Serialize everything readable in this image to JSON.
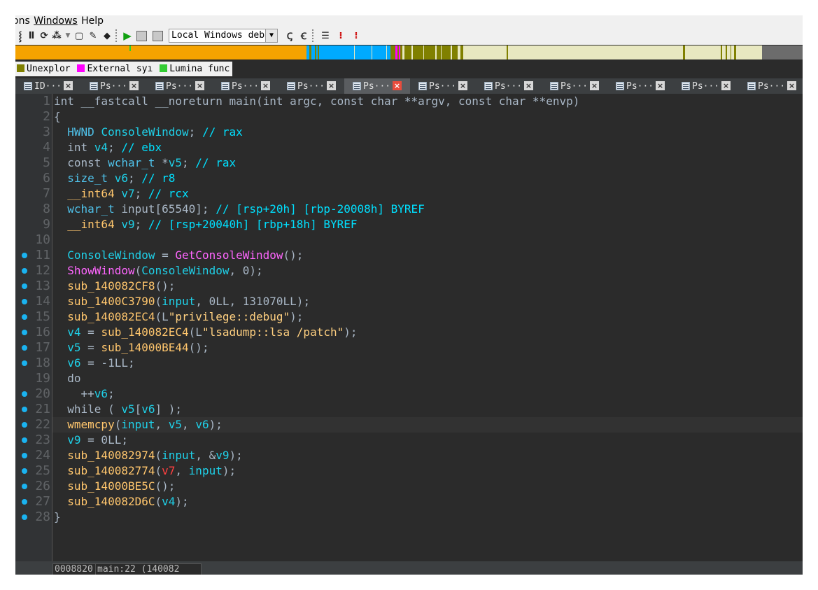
{
  "menubar": {
    "items": [
      "ons",
      "Windows",
      "Help"
    ]
  },
  "toolbar": {
    "debugger_select": "Local Windows deb",
    "icons": [
      "view-icon",
      "trace-icon",
      "loop-icon",
      "struct-icon",
      "dropdown-icon",
      "frame-icon",
      "edit-icon",
      "diamond-icon",
      "play-icon",
      "pause-icon",
      "stop-icon",
      "attach-icon",
      "detach-icon",
      "step-into-icon",
      "step-over-icon",
      "step-out-icon"
    ]
  },
  "legend": {
    "items": [
      {
        "label": "Unexplor",
        "color": "#808000"
      },
      {
        "label": "External syı",
        "color": "#ff00ff"
      },
      {
        "label": "Lumina func",
        "color": "#33cc33"
      }
    ]
  },
  "tabs": [
    {
      "label": "ID···",
      "active": false
    },
    {
      "label": "Ps···",
      "active": false
    },
    {
      "label": "Ps···",
      "active": false
    },
    {
      "label": "Ps···",
      "active": false
    },
    {
      "label": "Ps···",
      "active": false
    },
    {
      "label": "Ps···",
      "active": true
    },
    {
      "label": "Ps···",
      "active": false
    },
    {
      "label": "Ps···",
      "active": false
    },
    {
      "label": "Ps···",
      "active": false
    },
    {
      "label": "Ps···",
      "active": false
    },
    {
      "label": "Ps···",
      "active": false
    },
    {
      "label": "Ps···",
      "active": false
    }
  ],
  "colors": {
    "default": "#a9b7c6",
    "keyword": "#a9b7c6",
    "type": "#4fc1e9",
    "comment": "#00e0ff",
    "local": "#1fd0e8",
    "func": "#ffc66d",
    "import": "#ff66ff",
    "string": "#ffd080",
    "number": "#a9b7c6",
    "unk": "#ff4040",
    "breakpoint": "#1ab3f0"
  },
  "code": {
    "current_line": 22,
    "lines": [
      {
        "n": 1,
        "bp": false,
        "t": [
          [
            "default",
            "int __fastcall __noreturn main(int argc, const char **argv, const char **envp)"
          ]
        ]
      },
      {
        "n": 2,
        "bp": false,
        "t": [
          [
            "default",
            "{"
          ]
        ]
      },
      {
        "n": 3,
        "bp": false,
        "t": [
          [
            "default",
            "  "
          ],
          [
            "type",
            "HWND"
          ],
          [
            "default",
            " "
          ],
          [
            "local",
            "ConsoleWindow"
          ],
          [
            "default",
            "; "
          ],
          [
            "comment",
            "// rax"
          ]
        ]
      },
      {
        "n": 4,
        "bp": false,
        "t": [
          [
            "default",
            "  int "
          ],
          [
            "local",
            "v4"
          ],
          [
            "default",
            "; "
          ],
          [
            "comment",
            "// ebx"
          ]
        ]
      },
      {
        "n": 5,
        "bp": false,
        "t": [
          [
            "default",
            "  const "
          ],
          [
            "type",
            "wchar_t"
          ],
          [
            "default",
            " *"
          ],
          [
            "local",
            "v5"
          ],
          [
            "default",
            "; "
          ],
          [
            "comment",
            "// rax"
          ]
        ]
      },
      {
        "n": 6,
        "bp": false,
        "t": [
          [
            "default",
            "  "
          ],
          [
            "type",
            "size_t"
          ],
          [
            "default",
            " "
          ],
          [
            "local",
            "v6"
          ],
          [
            "default",
            "; "
          ],
          [
            "comment",
            "// r8"
          ]
        ]
      },
      {
        "n": 7,
        "bp": false,
        "t": [
          [
            "default",
            "  "
          ],
          [
            "func",
            "__int64"
          ],
          [
            "default",
            " "
          ],
          [
            "local",
            "v7"
          ],
          [
            "default",
            "; "
          ],
          [
            "comment",
            "// rcx"
          ]
        ]
      },
      {
        "n": 8,
        "bp": false,
        "t": [
          [
            "default",
            "  "
          ],
          [
            "type",
            "wchar_t"
          ],
          [
            "default",
            " input[65540]; "
          ],
          [
            "comment",
            "// [rsp+20h] [rbp-20008h] BYREF"
          ]
        ]
      },
      {
        "n": 9,
        "bp": false,
        "t": [
          [
            "default",
            "  "
          ],
          [
            "func",
            "__int64"
          ],
          [
            "default",
            " "
          ],
          [
            "local",
            "v9"
          ],
          [
            "default",
            "; "
          ],
          [
            "comment",
            "// [rsp+20040h] [rbp+18h] BYREF"
          ]
        ]
      },
      {
        "n": 10,
        "bp": false,
        "t": [
          [
            "default",
            ""
          ]
        ]
      },
      {
        "n": 11,
        "bp": true,
        "t": [
          [
            "default",
            "  "
          ],
          [
            "local",
            "ConsoleWindow"
          ],
          [
            "default",
            " = "
          ],
          [
            "import",
            "GetConsoleWindow"
          ],
          [
            "default",
            "();"
          ]
        ]
      },
      {
        "n": 12,
        "bp": true,
        "t": [
          [
            "default",
            "  "
          ],
          [
            "import",
            "ShowWindow"
          ],
          [
            "default",
            "("
          ],
          [
            "local",
            "ConsoleWindow"
          ],
          [
            "default",
            ", 0);"
          ]
        ]
      },
      {
        "n": 13,
        "bp": true,
        "t": [
          [
            "default",
            "  "
          ],
          [
            "func",
            "sub_140082CF8"
          ],
          [
            "default",
            "();"
          ]
        ]
      },
      {
        "n": 14,
        "bp": true,
        "t": [
          [
            "default",
            "  "
          ],
          [
            "func",
            "sub_1400C3790"
          ],
          [
            "default",
            "("
          ],
          [
            "local",
            "input"
          ],
          [
            "default",
            ", 0LL, 131070LL);"
          ]
        ]
      },
      {
        "n": 15,
        "bp": true,
        "t": [
          [
            "default",
            "  "
          ],
          [
            "func",
            "sub_140082EC4"
          ],
          [
            "default",
            "(L"
          ],
          [
            "string",
            "\"privilege::debug\""
          ],
          [
            "default",
            ");"
          ]
        ]
      },
      {
        "n": 16,
        "bp": true,
        "t": [
          [
            "default",
            "  "
          ],
          [
            "local",
            "v4"
          ],
          [
            "default",
            " = "
          ],
          [
            "func",
            "sub_140082EC4"
          ],
          [
            "default",
            "(L"
          ],
          [
            "string",
            "\"lsadump::lsa /patch\""
          ],
          [
            "default",
            ");"
          ]
        ]
      },
      {
        "n": 17,
        "bp": true,
        "t": [
          [
            "default",
            "  "
          ],
          [
            "local",
            "v5"
          ],
          [
            "default",
            " = "
          ],
          [
            "func",
            "sub_14000BE44"
          ],
          [
            "default",
            "();"
          ]
        ]
      },
      {
        "n": 18,
        "bp": true,
        "t": [
          [
            "default",
            "  "
          ],
          [
            "local",
            "v6"
          ],
          [
            "default",
            " = -1LL;"
          ]
        ]
      },
      {
        "n": 19,
        "bp": false,
        "t": [
          [
            "default",
            "  do"
          ]
        ]
      },
      {
        "n": 20,
        "bp": true,
        "t": [
          [
            "default",
            "    ++"
          ],
          [
            "local",
            "v6"
          ],
          [
            "default",
            ";"
          ]
        ]
      },
      {
        "n": 21,
        "bp": true,
        "t": [
          [
            "default",
            "  while ( "
          ],
          [
            "local",
            "v5"
          ],
          [
            "default",
            "["
          ],
          [
            "local",
            "v6"
          ],
          [
            "default",
            "] );"
          ]
        ]
      },
      {
        "n": 22,
        "bp": true,
        "t": [
          [
            "default",
            "  "
          ],
          [
            "func",
            "wmemcpy"
          ],
          [
            "default",
            "("
          ],
          [
            "local",
            "input"
          ],
          [
            "default",
            ", "
          ],
          [
            "local",
            "v5"
          ],
          [
            "default",
            ", "
          ],
          [
            "local",
            "v6"
          ],
          [
            "default",
            ");"
          ]
        ]
      },
      {
        "n": 23,
        "bp": true,
        "t": [
          [
            "default",
            "  "
          ],
          [
            "local",
            "v9"
          ],
          [
            "default",
            " = 0LL;"
          ]
        ]
      },
      {
        "n": 24,
        "bp": true,
        "t": [
          [
            "default",
            "  "
          ],
          [
            "func",
            "sub_140082974"
          ],
          [
            "default",
            "("
          ],
          [
            "local",
            "input"
          ],
          [
            "default",
            ", &"
          ],
          [
            "local",
            "v9"
          ],
          [
            "default",
            ");"
          ]
        ]
      },
      {
        "n": 25,
        "bp": true,
        "t": [
          [
            "default",
            "  "
          ],
          [
            "func",
            "sub_140082774"
          ],
          [
            "default",
            "("
          ],
          [
            "unk",
            "v7"
          ],
          [
            "default",
            ", "
          ],
          [
            "local",
            "input"
          ],
          [
            "default",
            ");"
          ]
        ]
      },
      {
        "n": 26,
        "bp": true,
        "t": [
          [
            "default",
            "  "
          ],
          [
            "func",
            "sub_14000BE5C"
          ],
          [
            "default",
            "();"
          ]
        ]
      },
      {
        "n": 27,
        "bp": true,
        "t": [
          [
            "default",
            "  "
          ],
          [
            "func",
            "sub_140082D6C"
          ],
          [
            "default",
            "("
          ],
          [
            "local",
            "v4"
          ],
          [
            "default",
            ");"
          ]
        ]
      },
      {
        "n": 28,
        "bp": true,
        "t": [
          [
            "default",
            "}"
          ]
        ]
      }
    ]
  },
  "status": {
    "address": "0008820",
    "location": "main:22 (140082"
  }
}
